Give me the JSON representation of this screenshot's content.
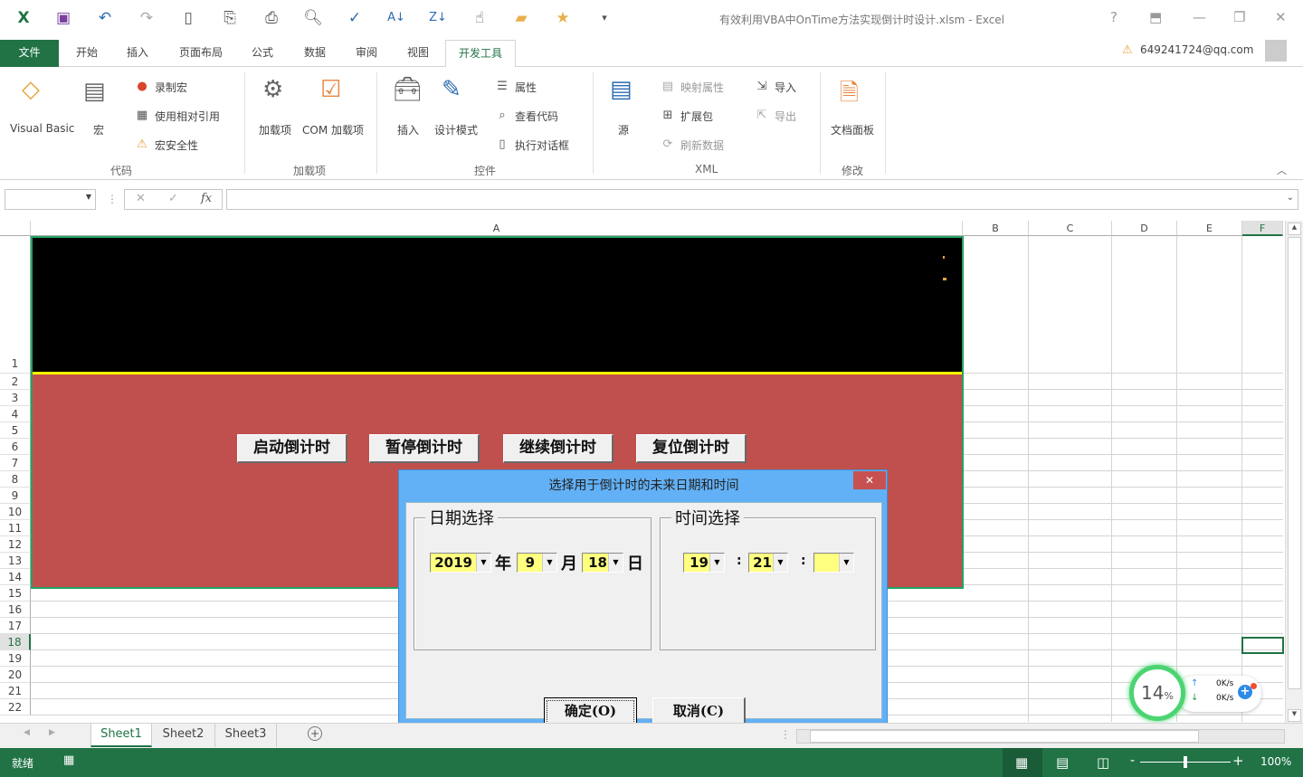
{
  "app": {
    "title": "有效利用VBA中OnTime方法实现倒计时设计.xlsm - Excel",
    "user": "649241724@qq.com"
  },
  "qat": {
    "icons": [
      "excel-icon",
      "save-icon",
      "undo-icon",
      "redo-icon",
      "new-icon",
      "attach-icon",
      "print-icon",
      "preview-icon",
      "spellcheck-icon",
      "sort-asc-icon",
      "sort-desc-icon",
      "touch-icon",
      "folder-icon",
      "favorite-icon",
      "customize-icon"
    ]
  },
  "tabs": [
    "文件",
    "开始",
    "插入",
    "页面布局",
    "公式",
    "数据",
    "审阅",
    "视图",
    "开发工具"
  ],
  "ribbon": {
    "code": {
      "label": "代码",
      "visual_basic": "Visual Basic",
      "macro": "宏",
      "record": "录制宏",
      "relative": "使用相对引用",
      "security": "宏安全性"
    },
    "addins": {
      "label": "加载项",
      "addins": "加载项",
      "com": "COM 加载项"
    },
    "controls": {
      "label": "控件",
      "insert": "插入",
      "design": "设计模式",
      "properties": "属性",
      "view_code": "查看代码",
      "run_dialog": "执行对话框"
    },
    "xml": {
      "label": "XML",
      "source": "源",
      "map_props": "映射属性",
      "expansion": "扩展包",
      "refresh": "刷新数据",
      "import": "导入",
      "export": "导出"
    },
    "modify": {
      "label": "修改",
      "doc_panel": "文档面板"
    }
  },
  "formula": {
    "fx": "fx",
    "cancel": "✕",
    "enter": "✓"
  },
  "columns": [
    "A",
    "B",
    "C",
    "D",
    "E",
    "F"
  ],
  "rows": [
    "1",
    "2",
    "3",
    "4",
    "5",
    "6",
    "7",
    "8",
    "9",
    "10",
    "11",
    "12",
    "13",
    "14",
    "15",
    "16",
    "17",
    "18",
    "19",
    "20",
    "21",
    "22"
  ],
  "buttons": {
    "start": "启动倒计时",
    "pause": "暂停倒计时",
    "resume": "继续倒计时",
    "reset": "复位倒计时"
  },
  "dialog": {
    "title": "选择用于倒计时的未来日期和时间",
    "close": "✕",
    "date_group": "日期选择",
    "time_group": "时间选择",
    "year": "2019",
    "year_unit": "年",
    "month": "9",
    "month_unit": "月",
    "day": "18",
    "day_unit": "日",
    "hour": "19",
    "sep1": ":",
    "minute": "21",
    "sep2": ":",
    "second": "",
    "ok": "确定(O)",
    "cancel": "取消(C)"
  },
  "sheets": [
    "Sheet1",
    "Sheet2",
    "Sheet3"
  ],
  "status": {
    "ready": "就绪",
    "zoom": "100%"
  },
  "widget": {
    "cpu": "14",
    "pct": "%",
    "up": "0K/s",
    "down": "0K/s"
  },
  "colors": {
    "excel_green": "#217346",
    "black_area": "#000000",
    "red_area": "#c0504d",
    "dialog_blue": "#62b0f5",
    "combo_yellow": "#ffff80"
  }
}
